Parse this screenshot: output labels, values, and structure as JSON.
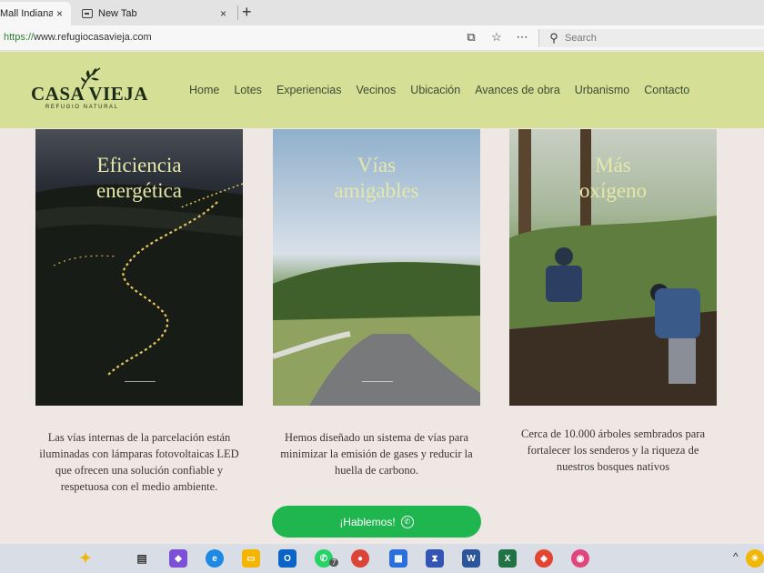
{
  "browser": {
    "tabs": [
      {
        "title": "Mall Indiana",
        "close": "×"
      },
      {
        "title": "New Tab",
        "close": "×"
      }
    ],
    "new_tab": "+",
    "url_protocol": "https://",
    "url_rest": "www.refugiocasavieja.com",
    "search_placeholder": "Search"
  },
  "site": {
    "logo_main": "CASA VIEJA",
    "logo_sub": "REFUGIO NATURAL",
    "nav": [
      "Home",
      "Lotes",
      "Experiencias",
      "Vecinos",
      "Ubicación",
      "Avances de obra",
      "Urbanismo",
      "Contacto"
    ],
    "cards": [
      {
        "title_1": "Eficiencia",
        "title_2": "energética",
        "description": "Las vías internas de la parcelación están iluminadas con lámparas fotovoltaicas LED que ofrecen una solución confiable y respetuosa con el medio ambiente."
      },
      {
        "title_1": "Vías",
        "title_2": "amigables",
        "description": "Hemos diseñado un sistema de vías para minimizar la emisión de gases y reducir la huella de carbono."
      },
      {
        "title_1": "Más",
        "title_2": "oxígeno",
        "description": "Cerca de 10.000 árboles sembrados para fortalecer los senderos y la riqueza de nuestros bosques nativos"
      }
    ],
    "cta_label": "¡Hablemos!"
  },
  "taskbar": {
    "badge_count": "7"
  }
}
